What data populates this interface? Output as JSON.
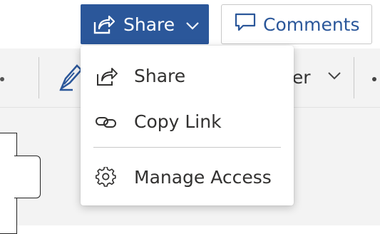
{
  "header": {
    "share_button_label": "Share",
    "comments_button_label": "Comments",
    "share_icon": "share-icon",
    "comments_icon": "comment-icon",
    "dropdown_icon": "chevron-down-icon"
  },
  "ribbon": {
    "partial_label": "ner"
  },
  "share_menu": {
    "items": [
      {
        "label": "Share",
        "icon": "share-icon"
      },
      {
        "label": "Copy Link",
        "icon": "link-icon"
      },
      {
        "label": "Manage Access",
        "icon": "gear-icon"
      }
    ]
  },
  "colors": {
    "accent": "#2b579a",
    "menu_text": "#323130",
    "ribbon_bg": "#f3f3f3"
  }
}
